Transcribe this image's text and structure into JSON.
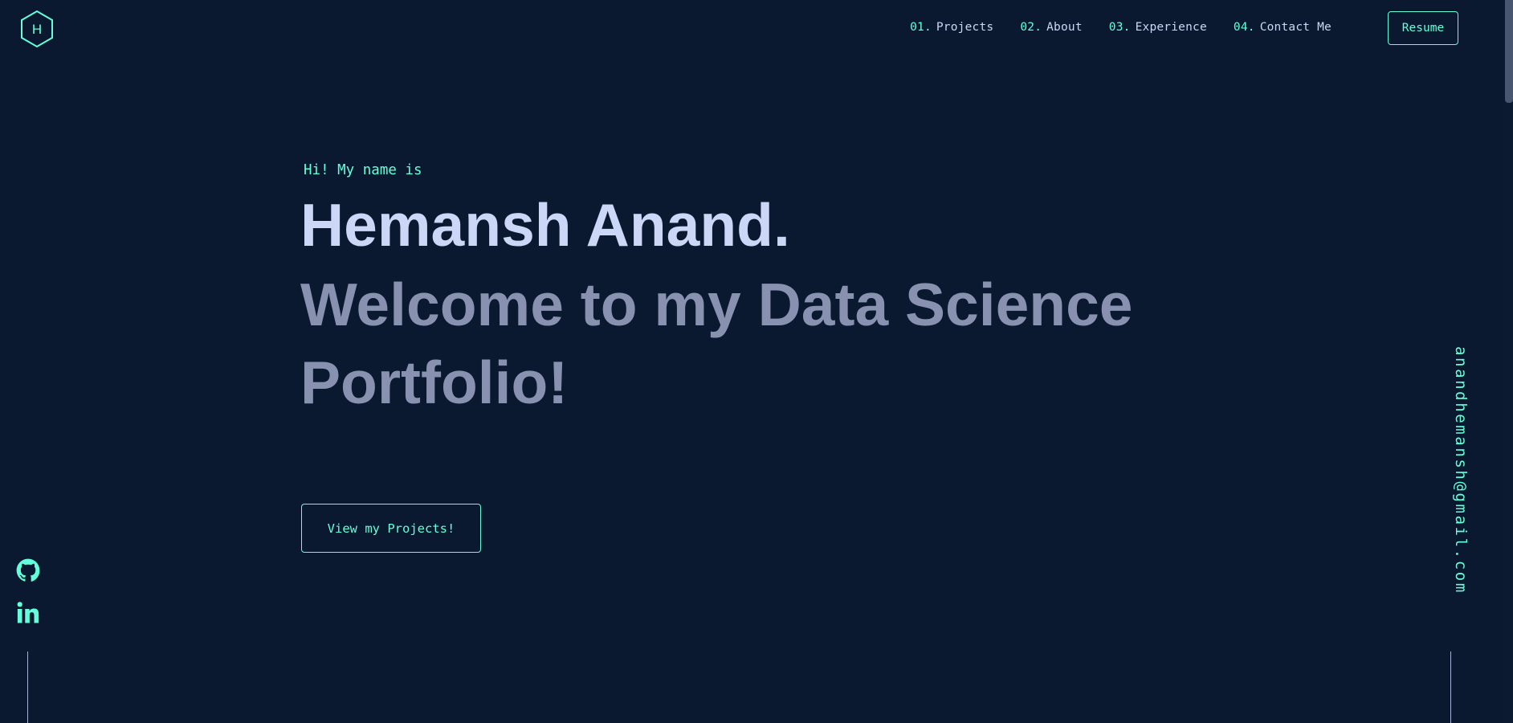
{
  "logo": {
    "letter": "H",
    "icon": "hexagon-logo-icon"
  },
  "nav": {
    "items": [
      {
        "num": "01.",
        "label": "Projects"
      },
      {
        "num": "02.",
        "label": "About"
      },
      {
        "num": "03.",
        "label": "Experience"
      },
      {
        "num": "04.",
        "label": "Contact Me"
      }
    ],
    "resume_label": "Resume"
  },
  "hero": {
    "intro": "Hi! My name is",
    "name": "Hemansh Anand.",
    "tagline": "Welcome to my Data Science Portfolio!",
    "cta_label": "View my Projects!"
  },
  "social": {
    "icons": [
      "github-icon",
      "linkedin-icon"
    ]
  },
  "email": "anandhemansh@gmail.com",
  "colors": {
    "background": "#0a192f",
    "accent": "#64ffda",
    "heading": "#ccd6f6",
    "muted": "#8892b0",
    "line": "#a8b2d1"
  }
}
